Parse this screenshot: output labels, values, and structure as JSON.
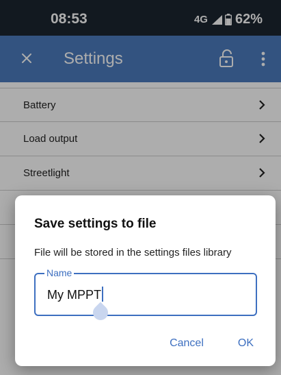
{
  "status_bar": {
    "time": "08:53",
    "network": "4G",
    "battery": "62%"
  },
  "app_bar": {
    "title": "Settings",
    "icons": [
      "close-icon",
      "lock-icon",
      "more-vert-icon"
    ]
  },
  "menu": {
    "items": [
      {
        "label": "Battery"
      },
      {
        "label": "Load output"
      },
      {
        "label": "Streetlight"
      }
    ]
  },
  "dialog": {
    "title": "Save settings to file",
    "description": "File will be stored in the settings files library",
    "field_label": "Name",
    "field_value": "My MPPT",
    "cancel_label": "Cancel",
    "ok_label": "OK"
  },
  "colors": {
    "status_bar": "#1b2530",
    "app_bar": "#4c7bbd",
    "accent": "#3d6fc0"
  }
}
